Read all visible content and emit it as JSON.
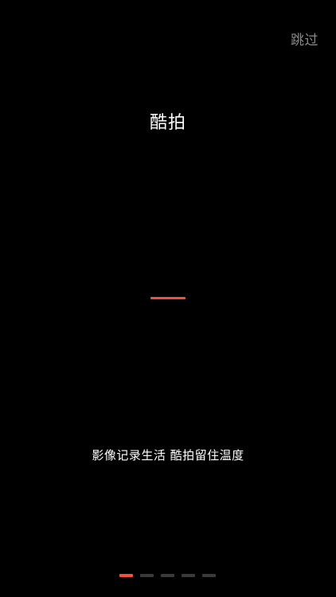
{
  "header": {
    "skip_label": "跳过"
  },
  "main": {
    "title": "酷拍",
    "tagline": "影像记录生活 酷拍留住温度"
  },
  "pager": {
    "page_count": 5,
    "active_index": 0
  },
  "colors": {
    "background": "#000000",
    "accent": "#f0503c",
    "inactive_dot": "#3a3a3a",
    "skip_text": "#8a8a8a",
    "text": "#ffffff"
  }
}
